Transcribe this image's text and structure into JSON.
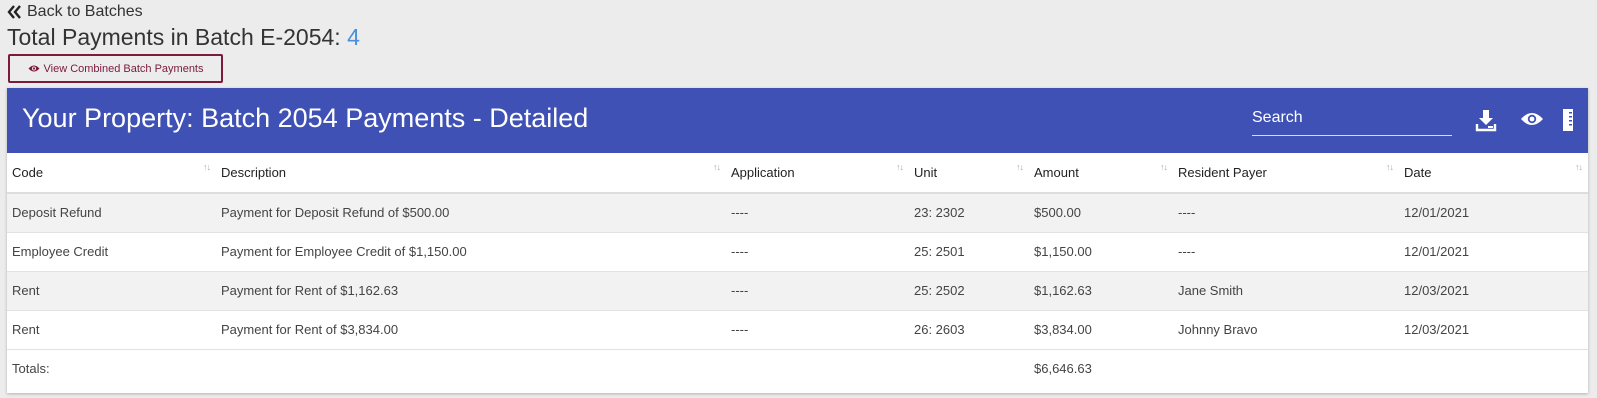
{
  "back_label": "Back to Batches",
  "title_prefix": "Total Payments in Batch E-2054: ",
  "payment_count": "4",
  "combined_button": "View Combined Batch Payments",
  "card": {
    "title": "Your Property: Batch 2054 Payments - Detailed",
    "search_placeholder": "Search"
  },
  "columns": [
    "Code",
    "Description",
    "Application",
    "Unit",
    "Amount",
    "Resident Payer",
    "Date"
  ],
  "rows": [
    [
      "Deposit Refund",
      "Payment for Deposit Refund of $500.00",
      "----",
      "23: 2302",
      "$500.00",
      "----",
      "12/01/2021"
    ],
    [
      "Employee Credit",
      "Payment for Employee Credit of $1,150.00",
      "----",
      "25: 2501",
      "$1,150.00",
      "----",
      "12/01/2021"
    ],
    [
      "Rent",
      "Payment for Rent of $1,162.63",
      "----",
      "25: 2502",
      "$1,162.63",
      "Jane Smith",
      "12/03/2021"
    ],
    [
      "Rent",
      "Payment for Rent of $3,834.00",
      "----",
      "26: 2603",
      "$3,834.00",
      "Johnny Bravo",
      "12/03/2021"
    ]
  ],
  "totals": {
    "label": "Totals:",
    "amount": "$6,646.63"
  },
  "colors": {
    "header_bg": "#3f51b5",
    "accent_count": "#4a8fd8",
    "button_border": "#7b1a3e"
  },
  "icons": [
    "double-chevron-left-icon",
    "eye-icon",
    "download-icon",
    "column-toggle-icon"
  ]
}
